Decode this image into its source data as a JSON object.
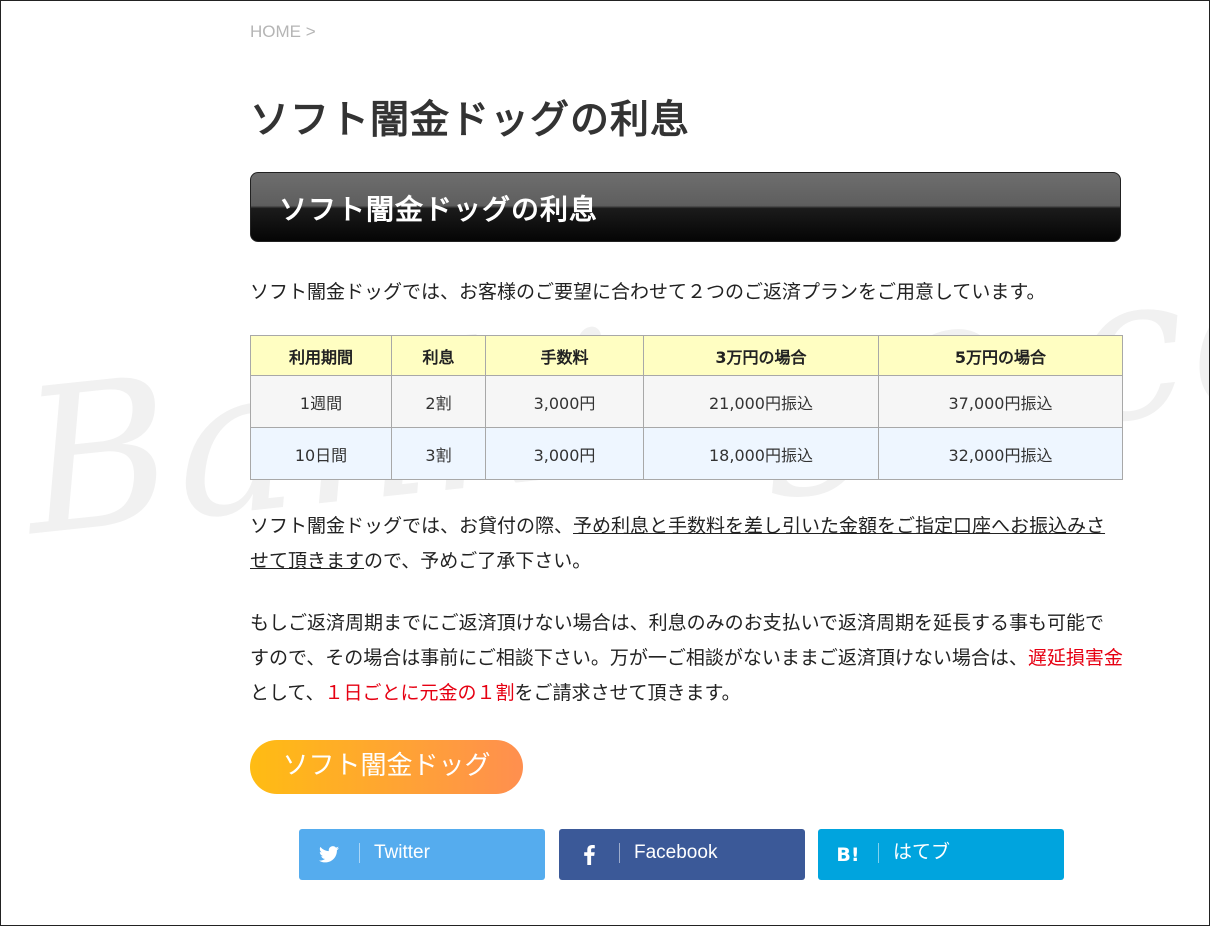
{
  "breadcrumb": "HOME >",
  "page_title": "ソフト闇金ドッグの利息",
  "section_heading": "ソフト闇金ドッグの利息",
  "intro": "ソフト闇金ドッグでは、お客様のご要望に合わせて２つのご返済プランをご用意しています。",
  "table": {
    "headers": [
      "利用期間",
      "利息",
      "手数料",
      "3万円の場合",
      "5万円の場合"
    ],
    "rows": [
      [
        "1週間",
        "2割",
        "3,000円",
        "21,000円振込",
        "37,000円振込"
      ],
      [
        "10日間",
        "3割",
        "3,000円",
        "18,000円振込",
        "32,000円振込"
      ]
    ]
  },
  "para2": {
    "prefix": "ソフト闇金ドッグでは、お貸付の際、",
    "underlined": "予め利息と手数料を差し引いた金額をご指定口座へお振込みさせて頂きます",
    "suffix": "ので、予めご了承下さい。"
  },
  "para3": {
    "text1": "もしご返済周期までにご返済頂けない場合は、利息のみのお支払いで返済周期を延長する事も可能ですので、その場合は事前にご相談下さい。万が一ご相談がないままご返済頂けない場合は、",
    "red1": "遅延損害金",
    "text2": "として、",
    "red2": "１日ごとに元金の１割",
    "text3": "をご請求させて頂きます。"
  },
  "cta_button": "ソフト闇金ドッグ",
  "share": {
    "twitter": "Twitter",
    "facebook": "Facebook",
    "hatena": "はてブ",
    "hatena_icon": "B!",
    "twitter_color": "#55acee",
    "facebook_color": "#3b5998",
    "hatena_color": "#00a4de"
  },
  "watermark": "Bankingo.com"
}
